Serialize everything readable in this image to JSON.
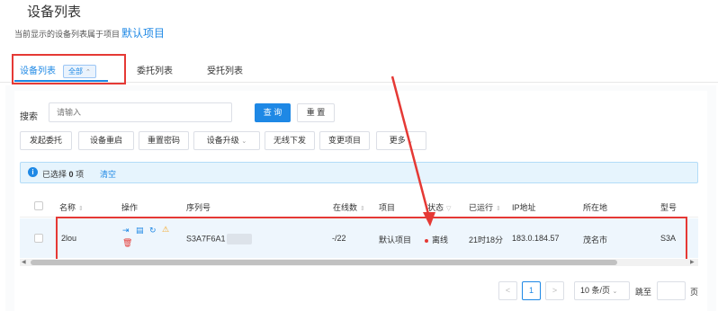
{
  "header": {
    "title": "设备列表",
    "subtitle_prefix": "当前显示的设备列表属于项目",
    "project_name": "默认项目"
  },
  "tabs": [
    {
      "label": "设备列表",
      "badge": "全部",
      "active": true
    },
    {
      "label": "委托列表",
      "active": false
    },
    {
      "label": "受托列表",
      "active": false
    }
  ],
  "search": {
    "label": "搜索",
    "placeholder": "请输入",
    "query_label": "查 询",
    "reset_label": "重 置"
  },
  "toolbar": [
    "发起委托",
    "设备重启",
    "重置密码",
    "设备升级",
    "无线下发",
    "变更项目",
    "更多"
  ],
  "alert": {
    "prefix": "已选择",
    "count": "0",
    "suffix": "项",
    "clear_label": "清空"
  },
  "table": {
    "columns": [
      "名称",
      "操作",
      "序列号",
      "在线数",
      "项目",
      "状态",
      "已运行",
      "IP地址",
      "所在地",
      "型号"
    ],
    "rows": [
      {
        "name": "2lou",
        "serial": "S3A7F6A1",
        "online": "-/22",
        "project": "默认项目",
        "status": "离线",
        "uptime": "21时18分",
        "ip": "183.0.184.57",
        "location": "茂名市",
        "model": "S3A"
      }
    ]
  },
  "pagination": {
    "prev": "<",
    "current": "1",
    "next": ">",
    "page_size": "10 条/页",
    "jump_label": "跳至",
    "page_label": "页"
  },
  "colors": {
    "accent": "#1e88e5",
    "highlight": "#e53935"
  }
}
